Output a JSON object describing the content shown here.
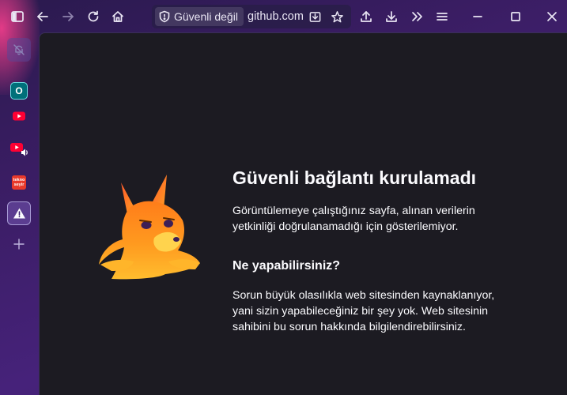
{
  "toolbar": {
    "site_info_label": "Güvenli değil",
    "url": "github.com"
  },
  "sidebar": {
    "items": [
      {
        "icon": "notifications-off-icon"
      },
      {
        "icon": "o-app-icon",
        "label": "O"
      },
      {
        "icon": "youtube-icon"
      },
      {
        "icon": "youtube-audio-icon"
      },
      {
        "icon": "teknoseyir-icon",
        "label": "tekno seyir"
      },
      {
        "icon": "warning-icon"
      },
      {
        "icon": "plus-icon"
      }
    ]
  },
  "error_page": {
    "title": "Güvenli bağlantı kurulamadı",
    "description": "Görüntülemeye çalıştığınız sayfa, alınan verilerin yetkinliği doğrulanamadığı için gösterilemiyor.",
    "subheading": "Ne yapabilirsiniz?",
    "body": "Sorun büyük olasılıkla web sitesinden kaynaklanıyor, yani sizin yapabileceğiniz bir şey yok. Web sitesinin sahibini bu sorun hakkında bilgilendirebilirsiniz."
  },
  "colors": {
    "content_bg": "#1c1b22",
    "text": "#fbfbfe",
    "chrome_purple": "#3a1d63",
    "youtube_red": "#ff0033",
    "o_app_teal": "#00707a",
    "teknoseyir_red": "#e8392b"
  }
}
